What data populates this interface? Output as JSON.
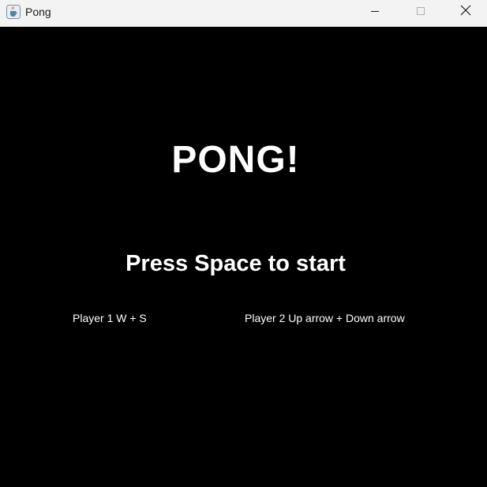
{
  "window": {
    "title": "Pong",
    "app_icon": "java-cup-icon",
    "controls": {
      "minimize": "minimize-icon",
      "maximize": "maximize-icon",
      "close": "close-icon"
    }
  },
  "game": {
    "background_color": "#000000",
    "text_color": "#ffffff",
    "title": "PONG!",
    "prompt": "Press Space to start",
    "player1_controls": "Player 1 W + S",
    "player2_controls": "Player 2 Up arrow + Down arrow"
  }
}
